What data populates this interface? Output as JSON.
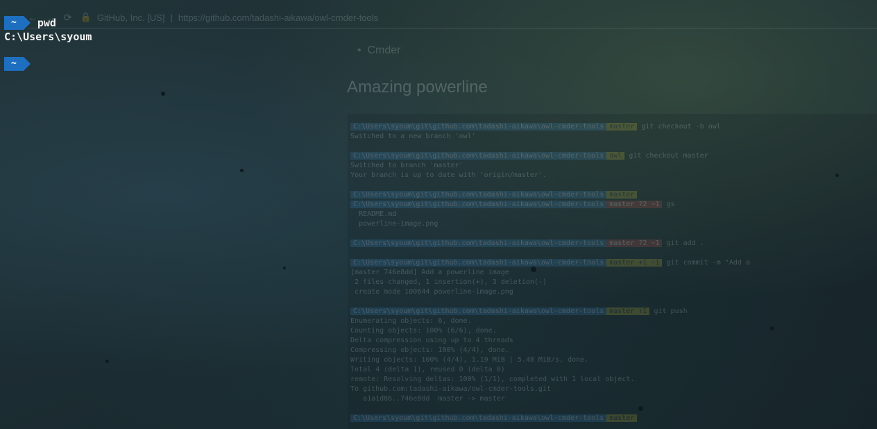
{
  "browser": {
    "nav_back": "←",
    "nav_forward": "→",
    "nav_reload": "⟳",
    "lock": "🔒",
    "site_name": "GitHub, Inc. [US]",
    "url": "https://github.com/tadashi-aikawa/owl-cmder-tools",
    "bullet_item": "Cmder",
    "heading": "Amazing powerline"
  },
  "inner_terminal": {
    "lines": [
      {
        "path": "C:\\Users\\syoum\\git\\github.com\\tadashi-aikawa\\owl-cmder-tools",
        "branch": "master",
        "cmd": "git checkout -b owl",
        "style": "yellow"
      },
      {
        "text": "Switched to a new branch 'owl'"
      },
      {
        "gap": true
      },
      {
        "path": "C:\\Users\\syoum\\git\\github.com\\tadashi-aikawa\\owl-cmder-tools",
        "branch": "owl",
        "cmd": "git checkout master",
        "style": "yellow"
      },
      {
        "text": "Switched to branch 'master'"
      },
      {
        "text": "Your branch is up to date with 'origin/master'."
      },
      {
        "gap": true
      },
      {
        "path": "C:\\Users\\syoum\\git\\github.com\\tadashi-aikawa\\owl-cmder-tools",
        "branch": "master",
        "cmd": "",
        "style": "yellow"
      },
      {
        "path": "C:\\Users\\syoum\\git\\github.com\\tadashi-aikawa\\owl-cmder-tools",
        "branch": "master ?2 ~1",
        "cmd": "gs",
        "style": "red"
      },
      {
        "text": "  README.md"
      },
      {
        "text": "  powerline-image.png"
      },
      {
        "gap": true
      },
      {
        "path": "C:\\Users\\syoum\\git\\github.com\\tadashi-aikawa\\owl-cmder-tools",
        "branch": "master ?2 ~1",
        "cmd": "git add .",
        "style": "red"
      },
      {
        "gap": true
      },
      {
        "path": "C:\\Users\\syoum\\git\\github.com\\tadashi-aikawa\\owl-cmder-tools",
        "branch": "master +1 ~1",
        "cmd": "git commit -m \"Add a",
        "style": "yellow"
      },
      {
        "text": "[master 746e8dd] Add a powerline image"
      },
      {
        "text": " 2 files changed, 1 insertion(+), 3 deletion(-)"
      },
      {
        "text": " create mode 100644 powerline-image.png"
      },
      {
        "gap": true
      },
      {
        "path": "C:\\Users\\syoum\\git\\github.com\\tadashi-aikawa\\owl-cmder-tools",
        "branch": "master ↑1",
        "cmd": "git push",
        "style": "yellow"
      },
      {
        "text": "Enumerating objects: 6, done."
      },
      {
        "text": "Counting objects: 100% (6/6), done."
      },
      {
        "text": "Delta compression using up to 4 threads"
      },
      {
        "text": "Compressing objects: 100% (4/4), done."
      },
      {
        "text": "Writing objects: 100% (4/4), 1.19 MiB | 5.48 MiB/s, done."
      },
      {
        "text": "Total 4 (delta 1), reused 0 (delta 0)"
      },
      {
        "text": "remote: Resolving deltas: 100% (1/1), completed with 1 local object."
      },
      {
        "text": "To github.com:tadashi-aikawa/owl-cmder-tools.git"
      },
      {
        "text": "   a1a1d86..746e8dd  master -> master"
      },
      {
        "gap": true
      },
      {
        "path": "C:\\Users\\syoum\\git\\github.com\\tadashi-aikawa\\owl-cmder-tools",
        "branch": "master",
        "cmd": "",
        "style": "yellow"
      }
    ]
  },
  "terminal": {
    "prompt1": {
      "segment": "~",
      "command": "pwd"
    },
    "output": "C:\\Users\\syoum",
    "prompt2": {
      "segment": "~",
      "command": ""
    }
  },
  "colors": {
    "prompt_segment": "#1e6fc0",
    "text": "#f2f2f2",
    "background": "#1b2a30"
  }
}
